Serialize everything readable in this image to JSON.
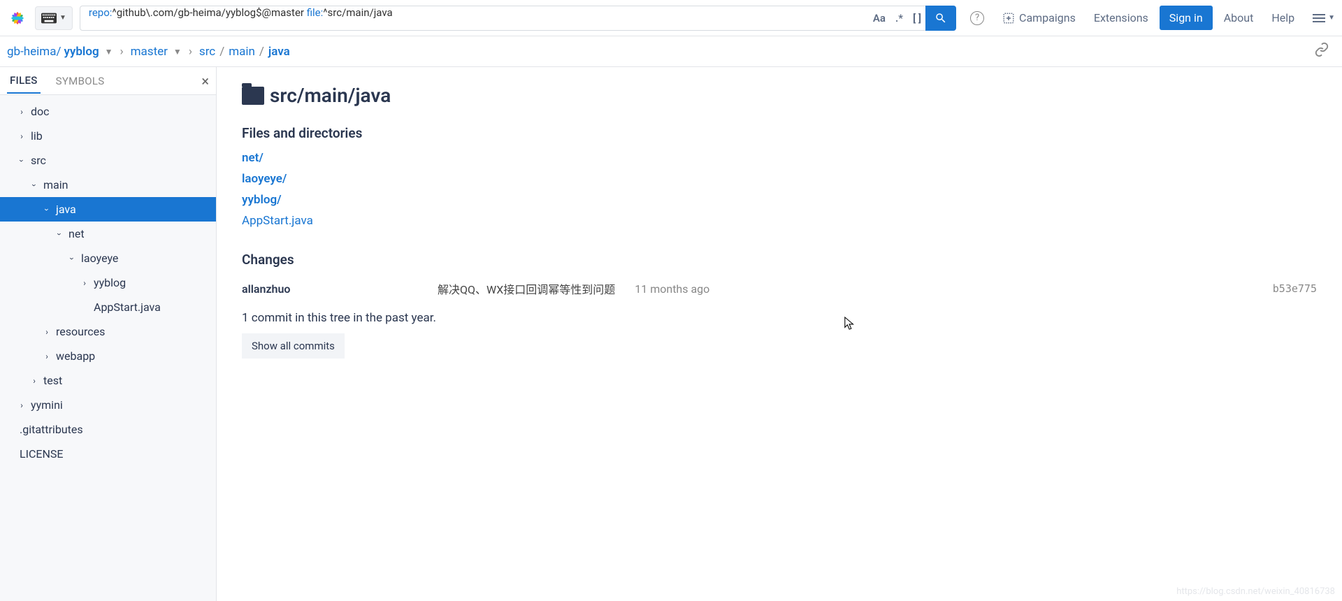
{
  "search": {
    "query_repo_kw": "repo:",
    "query_repo_val": "^github\\.com/gb-heima/yyblog$@master ",
    "query_file_kw": "file:",
    "query_file_val": "^src/main/java",
    "ctrl_case": "Aa",
    "ctrl_regex": ".*",
    "ctrl_struct": "[ ]"
  },
  "nav": {
    "campaigns": "Campaigns",
    "extensions": "Extensions",
    "signin": "Sign in",
    "about": "About",
    "help": "Help"
  },
  "crumb": {
    "owner": "gb-heima/",
    "repo": "yyblog",
    "branch": "master",
    "p1": "src",
    "p2": "main",
    "p3": "java"
  },
  "tabs": {
    "files": "FILES",
    "symbols": "SYMBOLS"
  },
  "tree": {
    "doc": "doc",
    "lib": "lib",
    "src": "src",
    "main": "main",
    "java": "java",
    "net": "net",
    "laoyeye": "laoyeye",
    "yyblog": "yyblog",
    "appstart": "AppStart.java",
    "resources": "resources",
    "webapp": "webapp",
    "test": "test",
    "yymini": "yymini",
    "gitattr": ".gitattributes",
    "license": "LICENSE"
  },
  "main": {
    "title": "src/main/java",
    "files_h": "Files and directories",
    "entries": {
      "net": "net/",
      "laoyeye": "laoyeye/",
      "yyblog": "yyblog/",
      "appstart": "AppStart.java"
    },
    "changes_h": "Changes",
    "commit": {
      "author": "allanzhuo",
      "msg": "解决QQ、WX接口回调幂等性到问题",
      "when": "11 months ago",
      "hash": "b53e775"
    },
    "summary": "1 commit in this tree in the past year.",
    "showall": "Show all commits"
  },
  "watermark": "https://blog.csdn.net/weixin_40816738"
}
